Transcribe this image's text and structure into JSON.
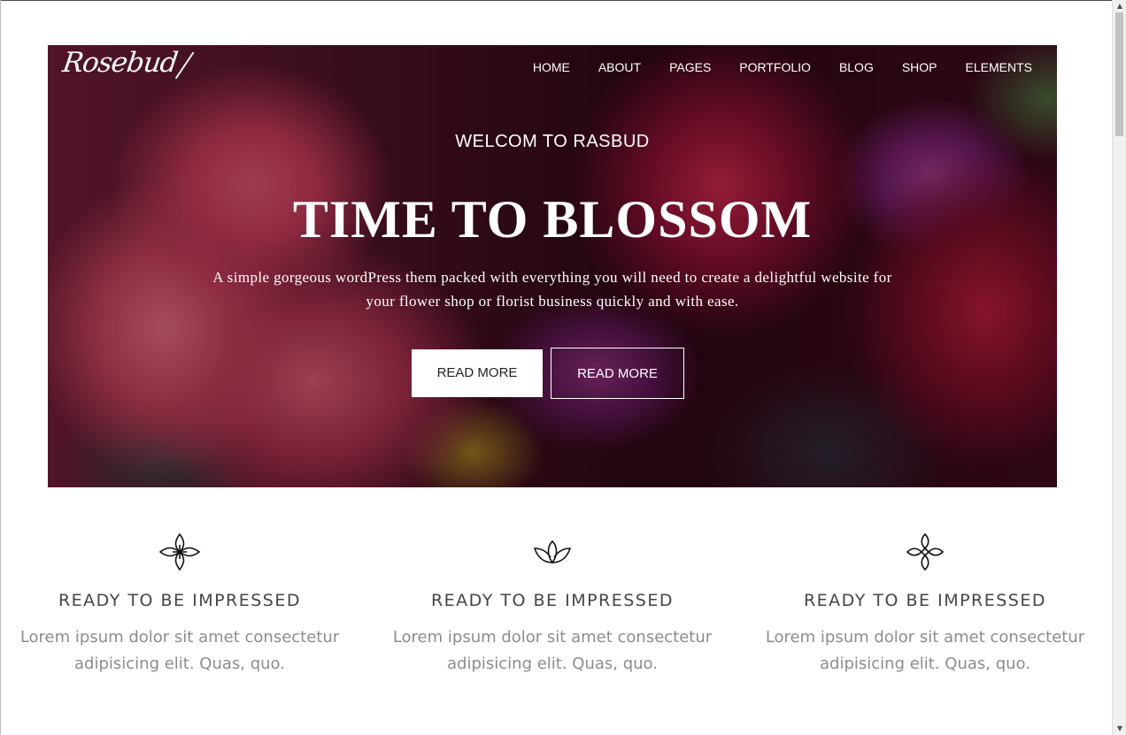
{
  "header": {
    "logo_text": "Rosebud",
    "nav": [
      "HOME",
      "ABOUT",
      "PAGES",
      "PORTFOLIO",
      "BLOG",
      "SHOP",
      "ELEMENTS"
    ]
  },
  "hero": {
    "welcome": "WELCOM TO RASBUD",
    "title": "TIME TO BLOSSOM",
    "description": "A simple gorgeous wordPress them packed with everything you will need to create a delightful website for your flower shop or florist business quickly and with ease.",
    "button_primary": "READ MORE",
    "button_secondary": "READ MORE"
  },
  "features": [
    {
      "icon": "four-petal-flower-icon",
      "title": "READY TO BE IMPRESSED",
      "text": "Lorem ipsum dolor sit amet consectetur adipisicing elit. Quas, quo."
    },
    {
      "icon": "lotus-icon",
      "title": "READY TO BE IMPRESSED",
      "text": "Lorem ipsum dolor sit amet consectetur adipisicing elit. Quas, quo."
    },
    {
      "icon": "diamond-flower-icon",
      "title": "READY TO BE IMPRESSED",
      "text": "Lorem ipsum dolor sit amet consectetur adipisicing elit. Quas, quo."
    }
  ],
  "colors": {
    "text_dark": "#454545",
    "text_muted": "#8c8c8c",
    "hero_overlay": "#2a0712"
  }
}
